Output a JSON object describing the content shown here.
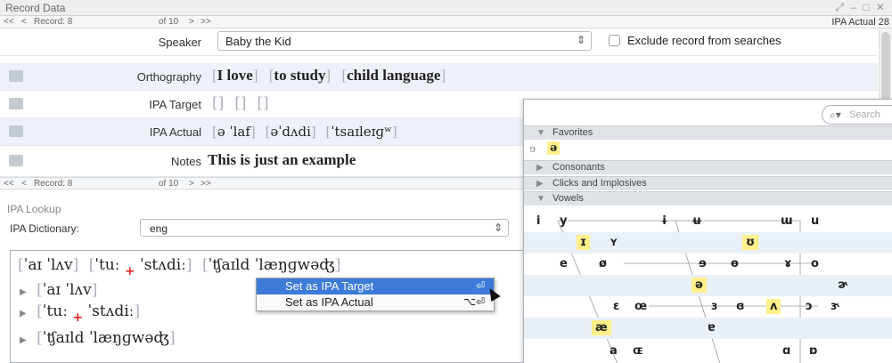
{
  "record_window": {
    "title": "Record Data",
    "window_controls": "⤢ – □ ✕",
    "nav": {
      "first": "<<",
      "prev": "<",
      "record_label": "Record: 8",
      "of": "of 10",
      "next": ">",
      "last": ">>"
    },
    "right_tab": "IPA Actual  28"
  },
  "tiers": {
    "speaker": {
      "label": "Speaker",
      "value": "Baby the Kid",
      "exclude_label": "Exclude record from searches"
    },
    "orthography": {
      "label": "Orthography",
      "groups": [
        "I love",
        "to study",
        "child language"
      ]
    },
    "ipa_target": {
      "label": "IPA Target",
      "groups": [
        "",
        "",
        ""
      ]
    },
    "ipa_actual": {
      "label": "IPA Actual",
      "groups": [
        "ə ˈlaf",
        "əˈdʌdi",
        "ˈtsaɪleɪɡʷ"
      ]
    },
    "notes": {
      "label": "Notes",
      "value": "This is just an example"
    }
  },
  "lookup": {
    "title": "IPA Lookup",
    "dict_label": "IPA Dictionary:",
    "dict_value": "eng",
    "top_line": {
      "w1": "ˈaɪ ˈlʌv",
      "w2a": "ˈtuː",
      "w2b": "ˈstʌdiː",
      "w3": "ˈʧaɪld ˈlæŋɡwəʤ"
    },
    "results": [
      "ˈaɪ ˈlʌv",
      "ˈtuː",
      "ˈstʌdiː",
      "ˈʧaɪld ˈlæŋɡwəʤ"
    ],
    "plus": "+"
  },
  "context_menu": {
    "item1": "Set as IPA Target",
    "item1_shortcut": "⏎",
    "item2": "Set as IPA Actual",
    "item2_shortcut": "⌥⏎"
  },
  "ipa_chart": {
    "search_placeholder": "Search",
    "sections": {
      "favorites": "Favorites",
      "consonants": "Consonants",
      "clicks": "Clicks and Implosives",
      "vowels": "Vowels"
    },
    "favorites": [
      "ɘ",
      "ə"
    ],
    "vowel_rows": [
      [
        "i",
        "y",
        "ɨ",
        "ʉ",
        "ɯ",
        "u"
      ],
      [
        "ɪ",
        "ʏ",
        "ʊ"
      ],
      [
        "e",
        "ø",
        "ɘ",
        "ɵ",
        "ɤ",
        "o"
      ],
      [
        "ə",
        "ɚ"
      ],
      [
        "ɛ",
        "œ",
        "ɜ",
        "ɞ",
        "ʌ",
        "ɔ",
        "ɝ"
      ],
      [
        "æ",
        "ɐ"
      ],
      [
        "a",
        "ɶ",
        "ɑ",
        "ɒ"
      ]
    ],
    "highlight_color": "#ffef8a"
  }
}
